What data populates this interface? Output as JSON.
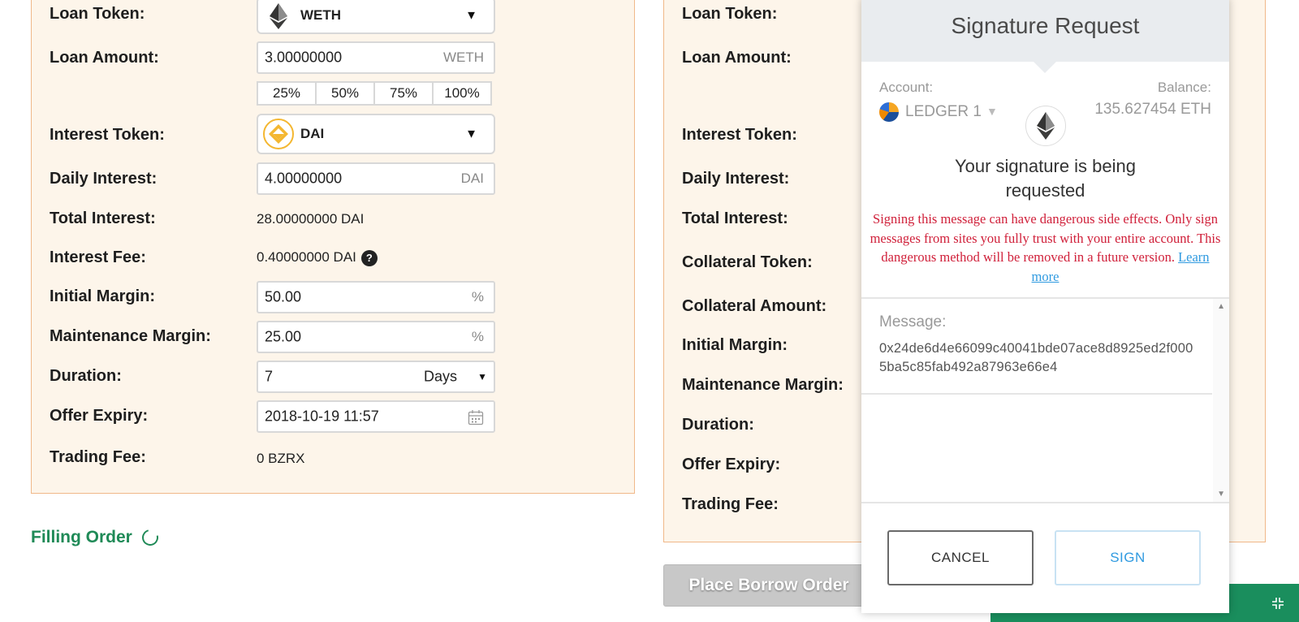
{
  "left_form": {
    "loan_token": {
      "label": "Loan Token:",
      "value": "WETH",
      "icon": "ethereum-icon"
    },
    "loan_amount": {
      "label": "Loan Amount:",
      "value": "3.00000000",
      "unit": "WETH"
    },
    "percent_buttons": [
      "25%",
      "50%",
      "75%",
      "100%"
    ],
    "interest_token": {
      "label": "Interest Token:",
      "value": "DAI",
      "icon": "dai-icon"
    },
    "daily_interest": {
      "label": "Daily Interest:",
      "value": "4.00000000",
      "unit": "DAI"
    },
    "total_interest": {
      "label": "Total Interest:",
      "value": "28.00000000 DAI"
    },
    "interest_fee": {
      "label": "Interest Fee:",
      "value": "0.40000000 DAI",
      "help": "?"
    },
    "initial_margin": {
      "label": "Initial Margin:",
      "value": "50.00",
      "unit": "%"
    },
    "maintenance_margin": {
      "label": "Maintenance Margin:",
      "value": "25.00",
      "unit": "%"
    },
    "duration": {
      "label": "Duration:",
      "value": "7",
      "unit_option": "Days"
    },
    "offer_expiry": {
      "label": "Offer Expiry:",
      "value": "2018-10-19 11:57",
      "icon": "calendar-icon"
    },
    "trading_fee": {
      "label": "Trading Fee:",
      "value": "0 BZRX"
    }
  },
  "filling_order": "Filling Order",
  "right_form": {
    "labels": {
      "loan_token": "Loan Token:",
      "loan_amount": "Loan Amount:",
      "interest_token": "Interest Token:",
      "daily_interest": "Daily Interest:",
      "total_interest": "Total Interest:",
      "collateral_token": "Collateral Token:",
      "collateral_amount": "Collateral Amount:",
      "initial_margin": "Initial Margin:",
      "maintenance_margin": "Maintenance Margin:",
      "duration": "Duration:",
      "offer_expiry": "Offer Expiry:",
      "trading_fee": "Trading Fee:"
    },
    "place_order_button": "Place Borrow Order"
  },
  "signature_popup": {
    "title": "Signature Request",
    "account_label": "Account:",
    "account_name": "LEDGER 1",
    "balance_label": "Balance:",
    "balance_value": "135.627454 ETH",
    "heading": "Your signature is being requested",
    "warning": "Signing this message can have dangerous side effects. Only sign messages from sites you fully trust with your entire account. This dangerous method will be removed in a future version.",
    "learn_more": "Learn more",
    "message_label": "Message:",
    "message_value": "0x24de6d4e66099c40041bde07ace8d8925ed2f0005ba5c85fab492a87963e66e4",
    "cancel_button": "CANCEL",
    "sign_button": "SIGN"
  },
  "colors": {
    "panel_bg": "#fdf5ea",
    "panel_border": "#f0b889",
    "accent_green": "#1f8a57",
    "warning_red": "#d0203a",
    "link_blue": "#2f9ae0"
  }
}
